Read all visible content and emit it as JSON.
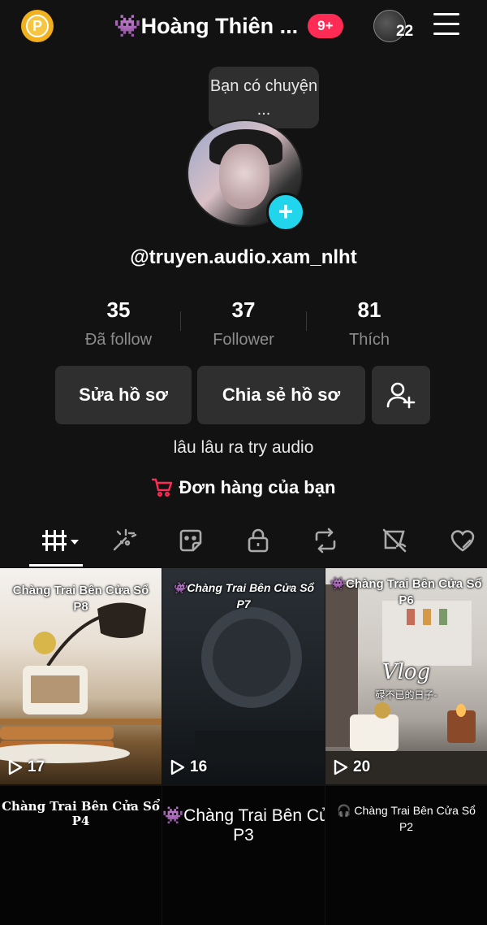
{
  "header": {
    "coin_letter": "P",
    "display_name": "👾Hoàng Thiên ...",
    "notification_badge": "9+",
    "friends_count": "22"
  },
  "profile": {
    "note_bubble": "Bạn có chuyện ...",
    "username": "@truyen.audio.xam_nlht",
    "stats": [
      {
        "value": "35",
        "label": "Đã follow"
      },
      {
        "value": "37",
        "label": "Follower"
      },
      {
        "value": "81",
        "label": "Thích"
      }
    ],
    "buttons": {
      "edit": "Sửa hồ sơ",
      "share": "Chia sẻ hồ sơ"
    },
    "bio": "lâu lâu ra try audio",
    "orders_label": "Đơn hàng của bạn"
  },
  "tabs": [
    "videos-grid",
    "sparkles",
    "sticker",
    "lock",
    "repost",
    "eye-slash",
    "heart-slash"
  ],
  "videos": [
    {
      "title": "Chàng Trai Bên Cửa Sổ",
      "part": "P8",
      "plays": "17"
    },
    {
      "title": "👾Chàng Trai Bên Cửa Sổ",
      "part": "P7",
      "plays": "16"
    },
    {
      "title": "👾Chàng Trai Bên Cửa Sổ",
      "part": "P6",
      "plays": "20",
      "overlay": "Vlog",
      "overlay_sub": "碌不已的日子-"
    }
  ],
  "videos_row2": [
    {
      "title": "Chàng Trai Bên Cửa Sổ",
      "part": "P4"
    },
    {
      "title": "👾Chàng Trai Bên Củ",
      "part": "P3"
    },
    {
      "title": "🎧 Chàng Trai Bên Cửa Sổ",
      "part": "P2"
    }
  ],
  "colors": {
    "accent_red": "#fe2c55",
    "plus_cyan": "#20d5ec",
    "coin": "#f2b01e",
    "background": "#121212"
  }
}
